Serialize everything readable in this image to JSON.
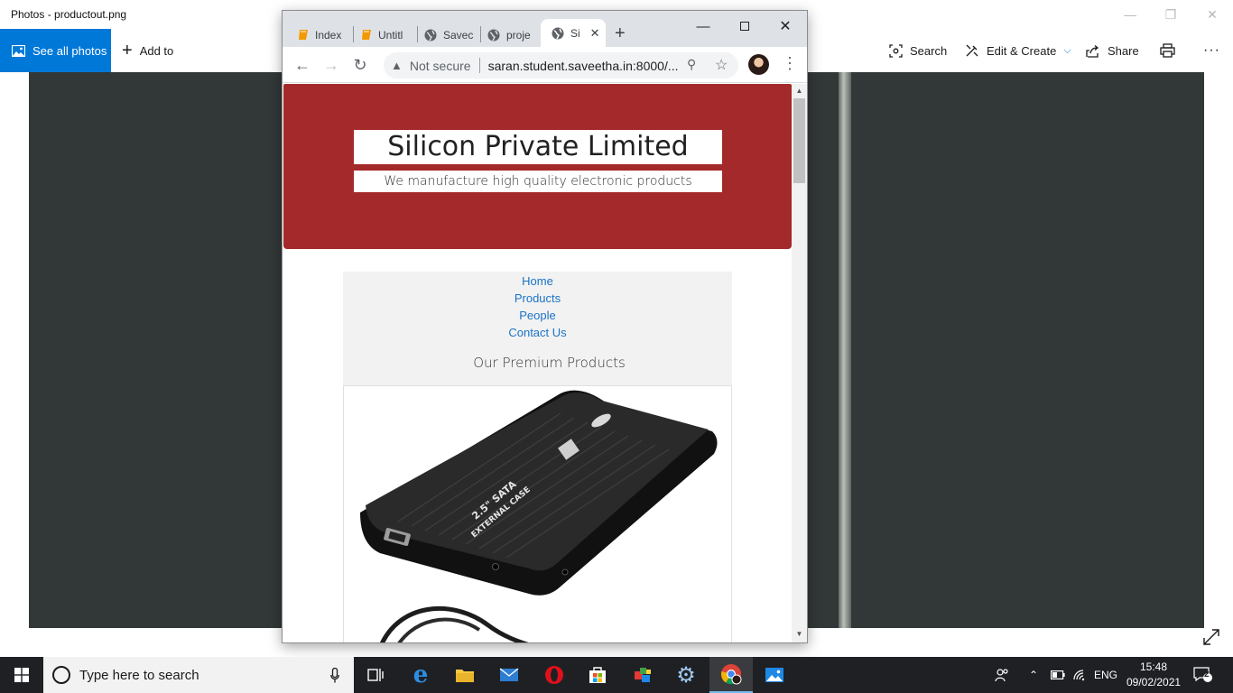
{
  "photos": {
    "window_title": "Photos - productout.png",
    "see_all_label": "See all photos",
    "add_to_label": "Add to",
    "search_label": "Search",
    "edit_create_label": "Edit & Create",
    "share_label": "Share"
  },
  "browser": {
    "tabs": [
      {
        "label": "Index",
        "icon": "book-icon",
        "color": "#f29900"
      },
      {
        "label": "Untitl",
        "icon": "book-icon",
        "color": "#f29900"
      },
      {
        "label": "Savec",
        "icon": "globe-icon"
      },
      {
        "label": "proje",
        "icon": "globe-icon"
      },
      {
        "label": "Si",
        "icon": "globe-icon",
        "active": true
      }
    ],
    "security_label": "Not secure",
    "url": "saran.student.saveetha.in:8000/..."
  },
  "page": {
    "company_name": "Silicon Private Limited",
    "tagline": "We manufacture high quality electronic products",
    "hero_color": "#a4292a",
    "nav": [
      "Home",
      "Products",
      "People",
      "Contact Us"
    ],
    "section_title": "Our Premium Products",
    "product": {
      "label_line1": "2.5\" SATA",
      "label_line2": "EXTERNAL CASE"
    }
  },
  "taskbar": {
    "search_placeholder": "Type here to search",
    "language": "ENG",
    "time": "15:48",
    "date": "09/02/2021",
    "notification_count": "2"
  }
}
